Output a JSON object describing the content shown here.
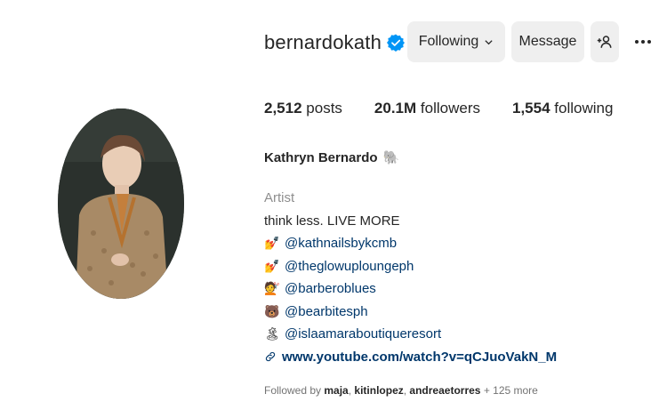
{
  "profile": {
    "username": "bernardokath",
    "verified": true,
    "full_name": "Kathryn Bernardo",
    "full_name_emoji": "🐘",
    "category": "Artist"
  },
  "actions": {
    "following_label": "Following",
    "message_label": "Message"
  },
  "stats": {
    "posts_count": "2,512",
    "posts_label": "posts",
    "followers_count": "20.1M",
    "followers_label": "followers",
    "following_count": "1,554",
    "following_label": "following"
  },
  "bio": {
    "tagline": "think less. LIVE MORE",
    "links": [
      {
        "emoji": "💅",
        "handle": "@kathnailsbykcmb"
      },
      {
        "emoji": "💅",
        "handle": "@theglowuploungeph"
      },
      {
        "emoji": "💇",
        "handle": "@barberoblues"
      },
      {
        "emoji": "🐻",
        "handle": "@bearbitesph"
      },
      {
        "emoji": "🏝",
        "handle": "@islaamaraboutiqueresort"
      }
    ],
    "website": "www.youtube.com/watch?v=qCJuoVakN_M"
  },
  "followed_by": {
    "prefix": "Followed by",
    "names": [
      "maja",
      "kitinlopez",
      "andreaetorres"
    ],
    "more": "+ 125 more"
  },
  "colors": {
    "verified_blue": "#0095f6",
    "button_bg": "#efefef",
    "link_color": "#00376b",
    "muted_text": "#8e8e8e"
  },
  "icons": {
    "verified": "verified-badge-icon",
    "following_chevron": "chevron-down-icon",
    "suggest": "add-person-icon",
    "more": "more-options-icon",
    "website": "link-icon"
  }
}
